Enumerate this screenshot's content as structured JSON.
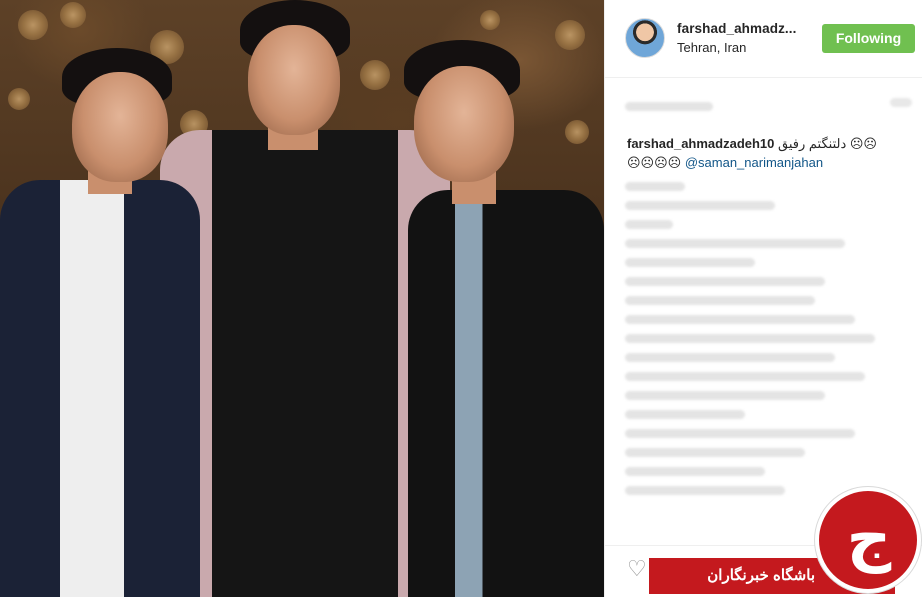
{
  "post": {
    "username": "farshad_ahmadz...",
    "location": "Tehran, Iran",
    "follow_label": "Following"
  },
  "caption": {
    "username": "farshad_ahmadzadeh10",
    "text": "دلتنگتم رفیق ☹☹",
    "line2_emojis": "☹☹☹☹",
    "mention": "@saman_narimanjahan"
  },
  "icons": {
    "like": "heart-icon",
    "avatar": "profile-avatar"
  },
  "watermark": {
    "text": "باشگاه خبرنگاران",
    "glyph": "ج"
  },
  "colors": {
    "follow_bg": "#70c050",
    "mention": "#125688",
    "watermark": "#c4191e"
  }
}
